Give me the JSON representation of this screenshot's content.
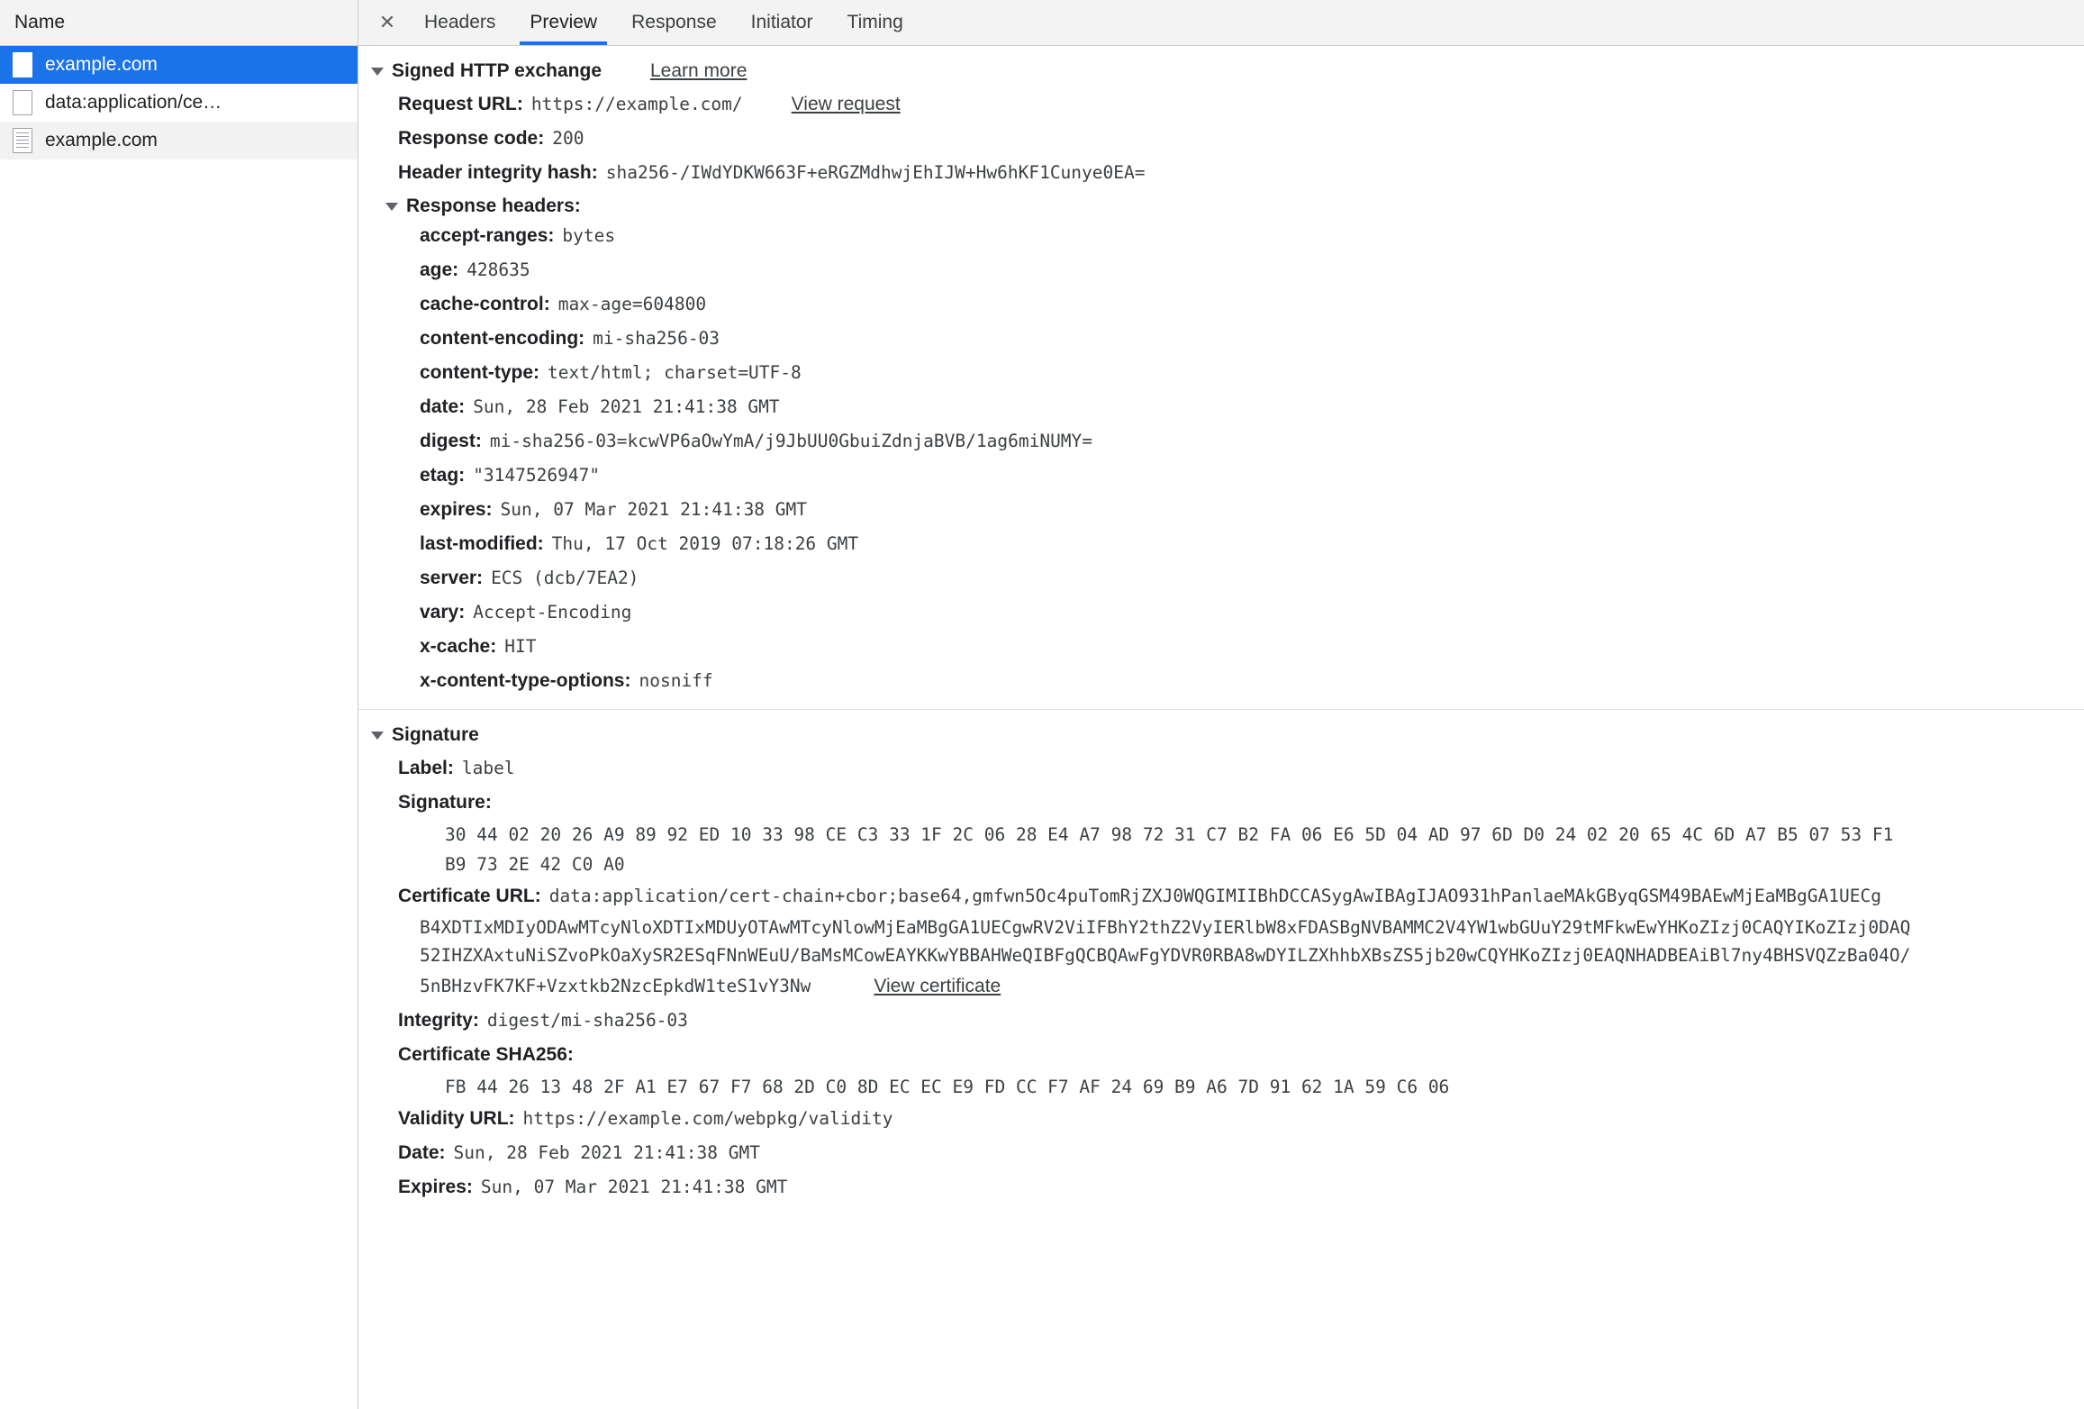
{
  "sidebar": {
    "column_header": "Name",
    "requests": [
      {
        "label": "example.com",
        "icon": "document-icon",
        "selected": true
      },
      {
        "label": "data:application/ce…",
        "icon": "document-icon",
        "selected": false
      },
      {
        "label": "example.com",
        "icon": "document-lines-icon",
        "selected": false
      }
    ]
  },
  "panel": {
    "close_label": "✕",
    "tabs": [
      {
        "label": "Headers",
        "active": false
      },
      {
        "label": "Preview",
        "active": true
      },
      {
        "label": "Response",
        "active": false
      },
      {
        "label": "Initiator",
        "active": false
      },
      {
        "label": "Timing",
        "active": false
      }
    ]
  },
  "exchange": {
    "title": "Signed HTTP exchange",
    "learn_more": "Learn more",
    "request_url_key": "Request URL:",
    "request_url_value": "https://example.com/",
    "view_request": "View request",
    "response_code_key": "Response code:",
    "response_code_value": "200",
    "header_integrity_key": "Header integrity hash:",
    "header_integrity_value": "sha256-/IWdYDKW663F+eRGZMdhwjEhIJW+Hw6hKF1Cunye0EA=",
    "response_headers_title": "Response headers:",
    "response_headers": [
      {
        "name": "accept-ranges:",
        "value": "bytes"
      },
      {
        "name": "age:",
        "value": "428635"
      },
      {
        "name": "cache-control:",
        "value": "max-age=604800"
      },
      {
        "name": "content-encoding:",
        "value": "mi-sha256-03"
      },
      {
        "name": "content-type:",
        "value": "text/html; charset=UTF-8"
      },
      {
        "name": "date:",
        "value": "Sun, 28 Feb 2021 21:41:38 GMT"
      },
      {
        "name": "digest:",
        "value": "mi-sha256-03=kcwVP6aOwYmA/j9JbUU0GbuiZdnjaBVB/1ag6miNUMY="
      },
      {
        "name": "etag:",
        "value": "\"3147526947\""
      },
      {
        "name": "expires:",
        "value": "Sun, 07 Mar 2021 21:41:38 GMT"
      },
      {
        "name": "last-modified:",
        "value": "Thu, 17 Oct 2019 07:18:26 GMT"
      },
      {
        "name": "server:",
        "value": "ECS (dcb/7EA2)"
      },
      {
        "name": "vary:",
        "value": "Accept-Encoding"
      },
      {
        "name": "x-cache:",
        "value": "HIT"
      },
      {
        "name": "x-content-type-options:",
        "value": "nosniff"
      }
    ]
  },
  "signature": {
    "title": "Signature",
    "label_key": "Label:",
    "label_value": "label",
    "signature_key": "Signature:",
    "signature_bytes_lines": [
      "30 44 02 20 26 A9 89 92 ED 10 33 98 CE C3 33 1F 2C 06 28 E4 A7 98 72 31 C7 B2 FA 06 E6 5D 04 AD 97 6D D0 24 02 20 65 4C 6D A7 B5 07 53 F1",
      "B9 73 2E 42 C0 A0"
    ],
    "certificate_url_key": "Certificate URL:",
    "certificate_url_lines": [
      "data:application/cert-chain+cbor;base64,gmfwn5Oc4puTomRjZXJ0WQGIMIIBhDCCASygAwIBAgIJAO931hPanlaeMAkGByqGSM49BAEwMjEaMBgGA1UECg",
      "B4XDTIxMDIyODAwMTcyNloXDTIxMDUyOTAwMTcyNlowMjEaMBgGA1UECgwRV2ViIFBhY2thZ2VyIERlbW8xFDASBgNVBAMMC2V4YW1wbGUuY29tMFkwEwYHKoZIzj0CAQYIKoZIzj0DAQ",
      "52IHZXAxtuNiSZvoPkOaXySR2ESqFNnWEuU/BaMsMCowEAYKKwYBBAHWeQIBFgQCBQAwFgYDVR0RBA8wDYILZXhhbXBsZS5jb20wCQYHKoZIzj0EAQNHADBEAiBl7ny4BHSVQZzBa04O/",
      "5nBHzvFK7KF+Vzxtkb2NzcEpkdW1teS1vY3Nw"
    ],
    "view_certificate": "View certificate",
    "integrity_key": "Integrity:",
    "integrity_value": "digest/mi-sha256-03",
    "cert_sha256_key": "Certificate SHA256:",
    "cert_sha256_value": "FB 44 26 13 48 2F A1 E7 67 F7 68 2D C0 8D EC EC E9 FD CC F7 AF 24 69 B9 A6 7D 91 62 1A 59 C6 06",
    "validity_url_key": "Validity URL:",
    "validity_url_value": "https://example.com/webpkg/validity",
    "date_key": "Date:",
    "date_value": "Sun, 28 Feb 2021 21:41:38 GMT",
    "expires_key": "Expires:",
    "expires_value": "Sun, 07 Mar 2021 21:41:38 GMT"
  },
  "colors": {
    "accent": "#1a73e8",
    "selected_row_bg": "#1a73e8",
    "toolbar_bg": "#f3f3f3",
    "text": "#202124"
  }
}
